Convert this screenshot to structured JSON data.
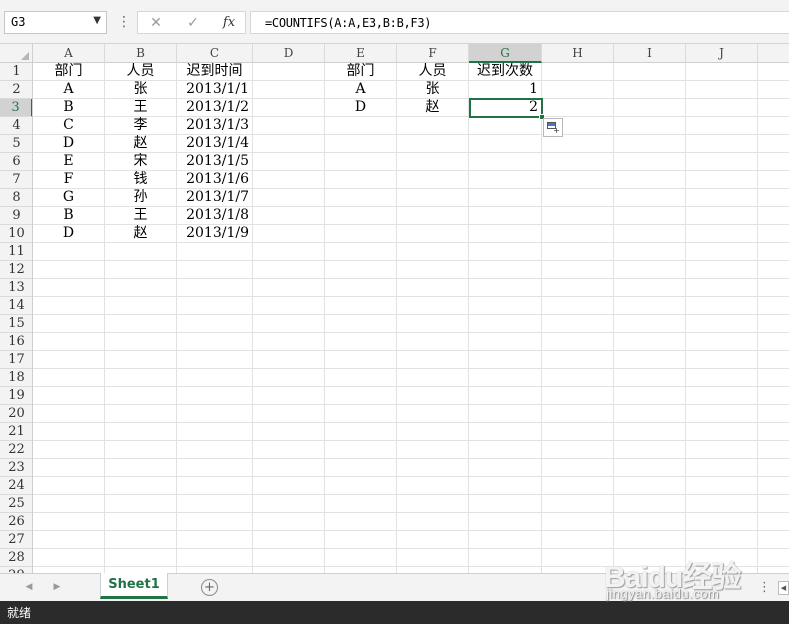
{
  "formula_bar": {
    "name_box": "G3",
    "more_icon": "vertical-ellipsis",
    "cancel_symbol": "✕",
    "enter_symbol": "✓",
    "fx_label": "fx",
    "formula": "=COUNTIFS(A:A,E3,B:B,F3)"
  },
  "columns": [
    "A",
    "B",
    "C",
    "D",
    "E",
    "F",
    "G",
    "H",
    "I",
    "J"
  ],
  "selected_column": "G",
  "rows": [
    "1",
    "2",
    "3",
    "4",
    "5",
    "6",
    "7",
    "8",
    "9",
    "10",
    "11",
    "12",
    "13",
    "14",
    "15",
    "16",
    "17",
    "18",
    "19",
    "20",
    "21",
    "22",
    "23",
    "24",
    "25",
    "26",
    "27",
    "28",
    "29"
  ],
  "selected_row": "3",
  "table_left": {
    "headers": [
      "部门",
      "人员",
      "迟到时间"
    ],
    "rows": [
      [
        "A",
        "张",
        "2013/1/1"
      ],
      [
        "B",
        "王",
        "2013/1/2"
      ],
      [
        "C",
        "李",
        "2013/1/3"
      ],
      [
        "D",
        "赵",
        "2013/1/4"
      ],
      [
        "E",
        "宋",
        "2013/1/5"
      ],
      [
        "F",
        "钱",
        "2013/1/6"
      ],
      [
        "G",
        "孙",
        "2013/1/7"
      ],
      [
        "B",
        "王",
        "2013/1/8"
      ],
      [
        "D",
        "赵",
        "2013/1/9"
      ]
    ]
  },
  "table_right": {
    "headers": [
      "部门",
      "人员",
      "迟到次数"
    ],
    "rows": [
      [
        "A",
        "张",
        "1"
      ],
      [
        "D",
        "赵",
        "2"
      ]
    ]
  },
  "active_cell": "G3",
  "sheet_tabs": {
    "active": "Sheet1",
    "add_symbol": "+",
    "split_symbol": "⋮"
  },
  "status_bar": {
    "text": "就绪"
  },
  "watermark": {
    "logo": "Baidu经验",
    "site": "jingyan.baidu.com"
  },
  "colors": {
    "accent": "#217346",
    "status_bar": "#2b2b2b",
    "header_bg": "#f3f3f3",
    "grid": "#e2e2e2"
  }
}
